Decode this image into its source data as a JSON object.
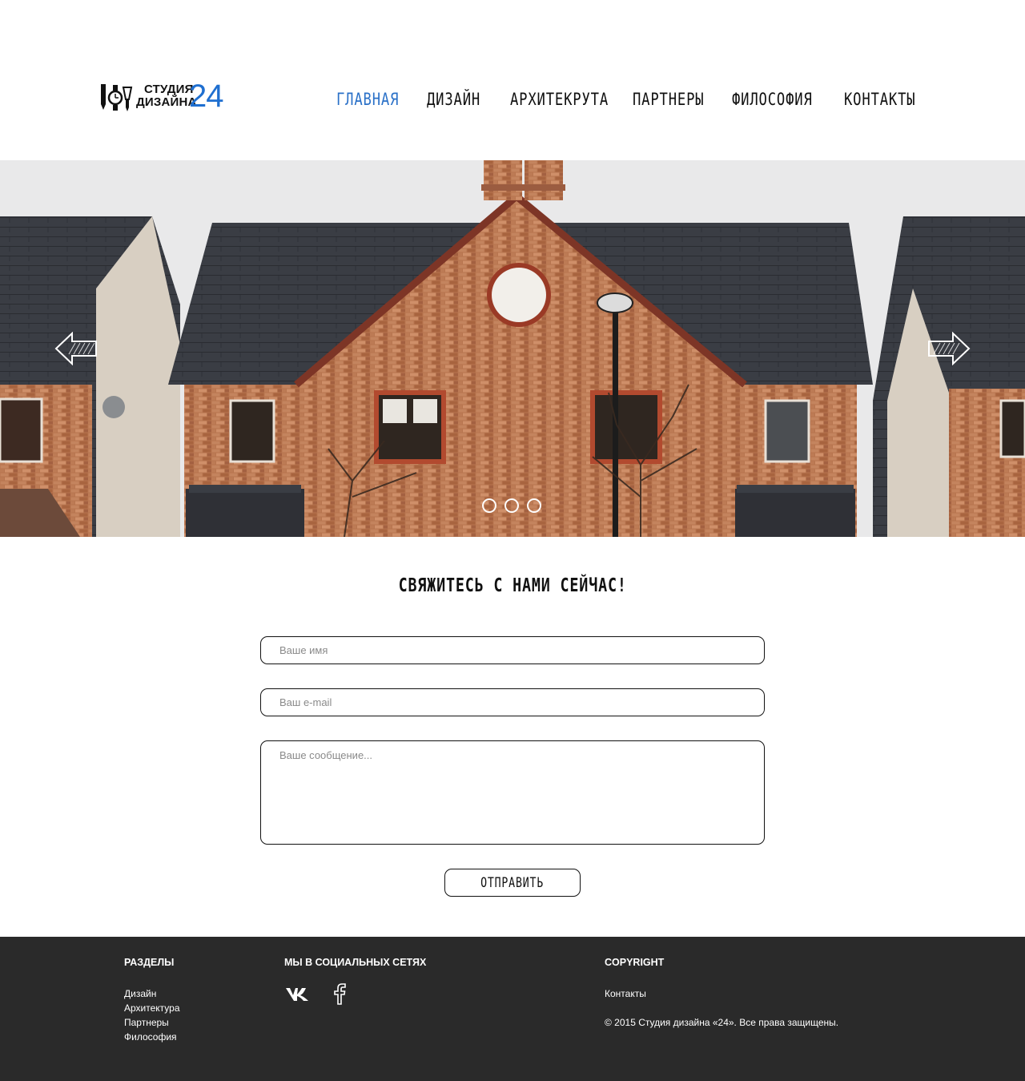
{
  "logo": {
    "line1": "СТУДИЯ",
    "line2": "ДИЗАЙНА",
    "number": "24",
    "tools_icon": "pencil-watch-pen-icons"
  },
  "nav": {
    "items": [
      {
        "label": "главная",
        "active": true
      },
      {
        "label": "дизайн",
        "active": false
      },
      {
        "label": "архитекрута",
        "active": false
      },
      {
        "label": "партнеры",
        "active": false
      },
      {
        "label": "философия",
        "active": false
      },
      {
        "label": "контакты",
        "active": false
      }
    ],
    "active_color": "#2b71c8"
  },
  "slider": {
    "image": "brick-houses-photo",
    "prev_icon": "arrow-left-icon",
    "next_icon": "arrow-right-icon",
    "dots": 3
  },
  "contact": {
    "title": "свяжитесь с нами сейчас!",
    "name_placeholder": "Ваше имя",
    "email_placeholder": "Ваш e-mail",
    "message_placeholder": "Ваше сообщение...",
    "submit_label": "отправить"
  },
  "footer": {
    "sections_title": "РАЗДЕЛЫ",
    "sections": [
      "Дизайн",
      "Архитектура",
      "Партнеры",
      "Философия"
    ],
    "social_title": "МЫ В СОЦИАЛЬНЫХ СЕТЯХ",
    "social_icons": [
      "vk-icon",
      "facebook-icon"
    ],
    "copyright_title": "COPYRIGHT",
    "contacts_link": "Контакты",
    "copyright_text": "© 2015 Студия дизайна «24». Все права защищены.",
    "background": "#2a2a2a"
  }
}
